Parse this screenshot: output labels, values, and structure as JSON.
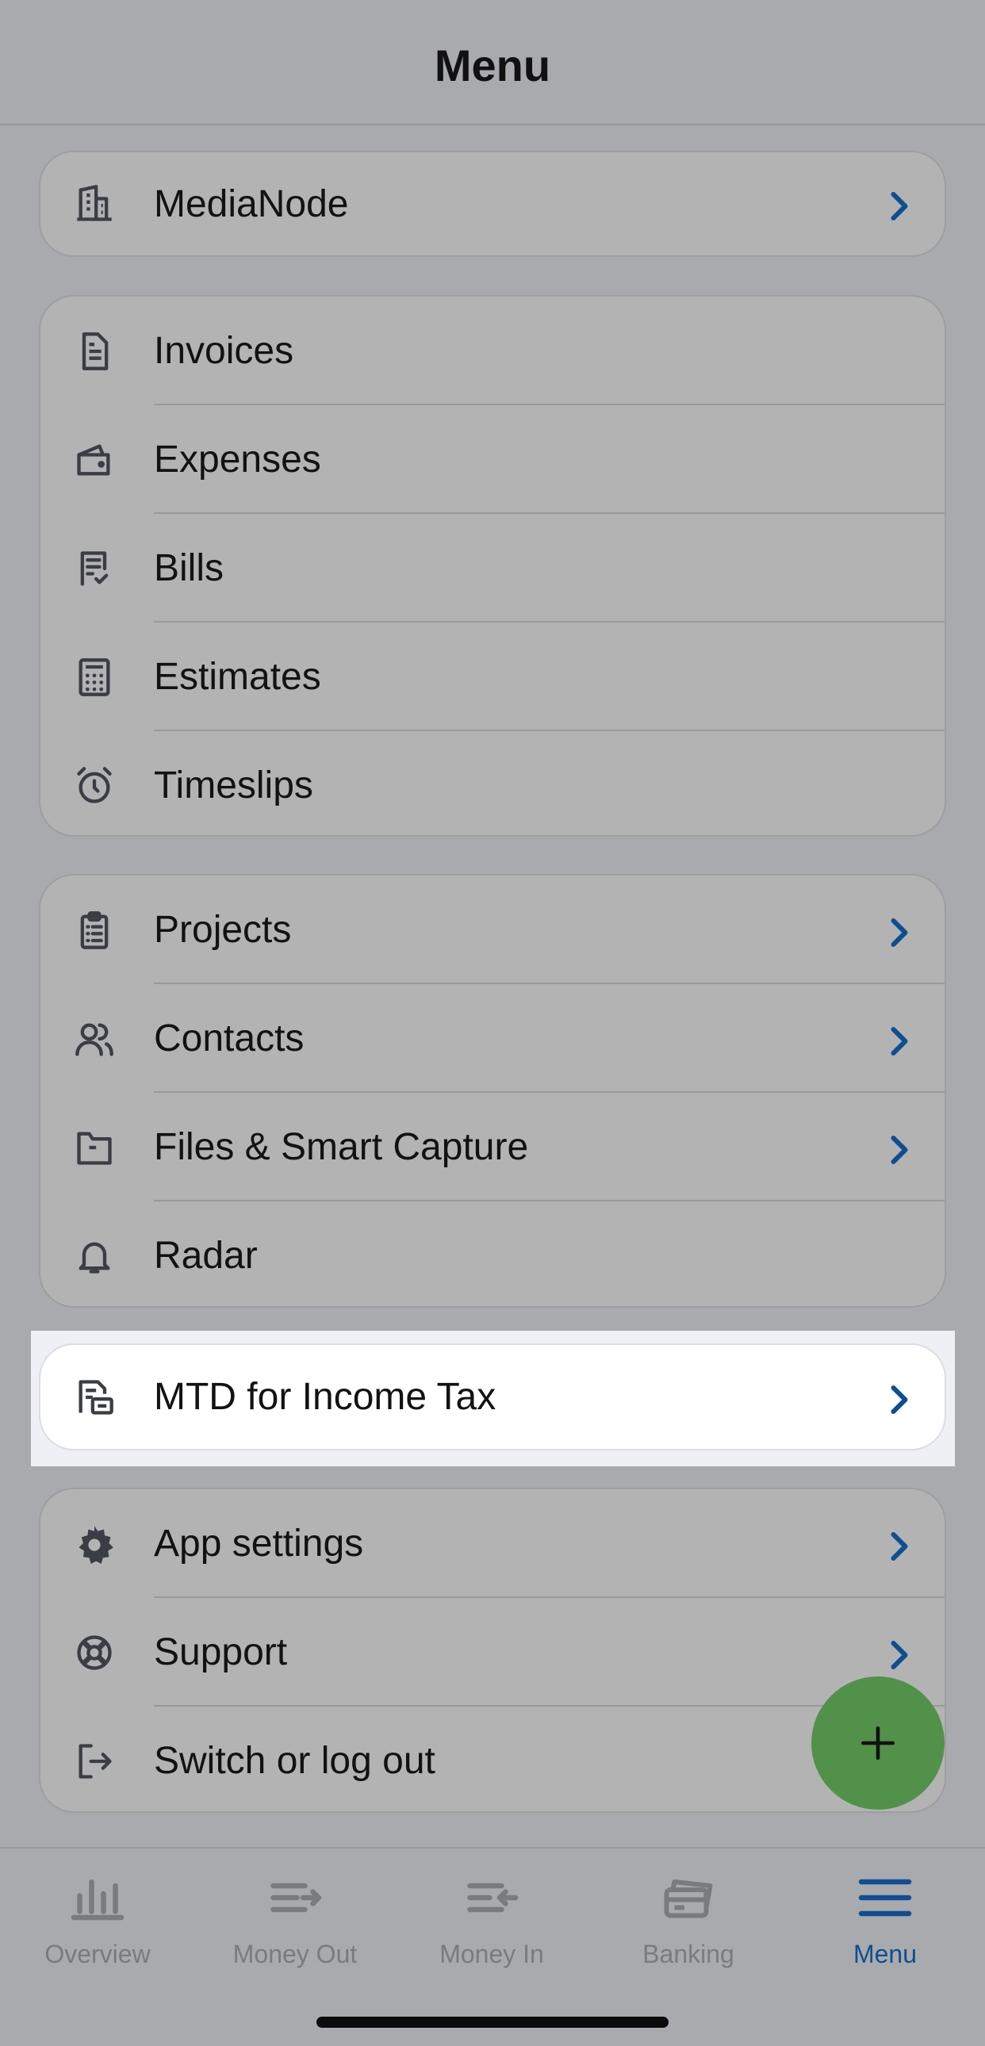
{
  "header": {
    "title": "Menu"
  },
  "groups": {
    "company": [
      {
        "label": "MediaNode",
        "icon": "building-icon"
      }
    ],
    "documents": [
      {
        "label": "Invoices",
        "icon": "document-icon"
      },
      {
        "label": "Expenses",
        "icon": "wallet-icon"
      },
      {
        "label": "Bills",
        "icon": "bill-check-icon"
      },
      {
        "label": "Estimates",
        "icon": "calculator-icon"
      },
      {
        "label": "Timeslips",
        "icon": "alarm-clock-icon"
      }
    ],
    "work": [
      {
        "label": "Projects",
        "icon": "clipboard-icon"
      },
      {
        "label": "Contacts",
        "icon": "people-icon"
      },
      {
        "label": "Files & Smart Capture",
        "icon": "folder-icon"
      },
      {
        "label": "Radar",
        "icon": "bell-icon"
      }
    ],
    "tax": [
      {
        "label": "MTD for Income Tax",
        "icon": "tax-document-icon"
      }
    ],
    "settings": [
      {
        "label": "App settings",
        "icon": "gear-icon"
      },
      {
        "label": "Support",
        "icon": "lifebuoy-icon"
      },
      {
        "label": "Switch or log out",
        "icon": "logout-icon"
      }
    ]
  },
  "fab": {
    "icon": "plus-icon"
  },
  "tabs": [
    {
      "label": "Overview",
      "icon": "overview-icon"
    },
    {
      "label": "Money Out",
      "icon": "money-out-icon"
    },
    {
      "label": "Money In",
      "icon": "money-in-icon"
    },
    {
      "label": "Banking",
      "icon": "banking-icon"
    },
    {
      "label": "Menu",
      "icon": "menu-icon",
      "active": true
    }
  ],
  "colors": {
    "accent": "#0e4f91",
    "fab": "#52914a",
    "highlight": "#ffffff"
  }
}
